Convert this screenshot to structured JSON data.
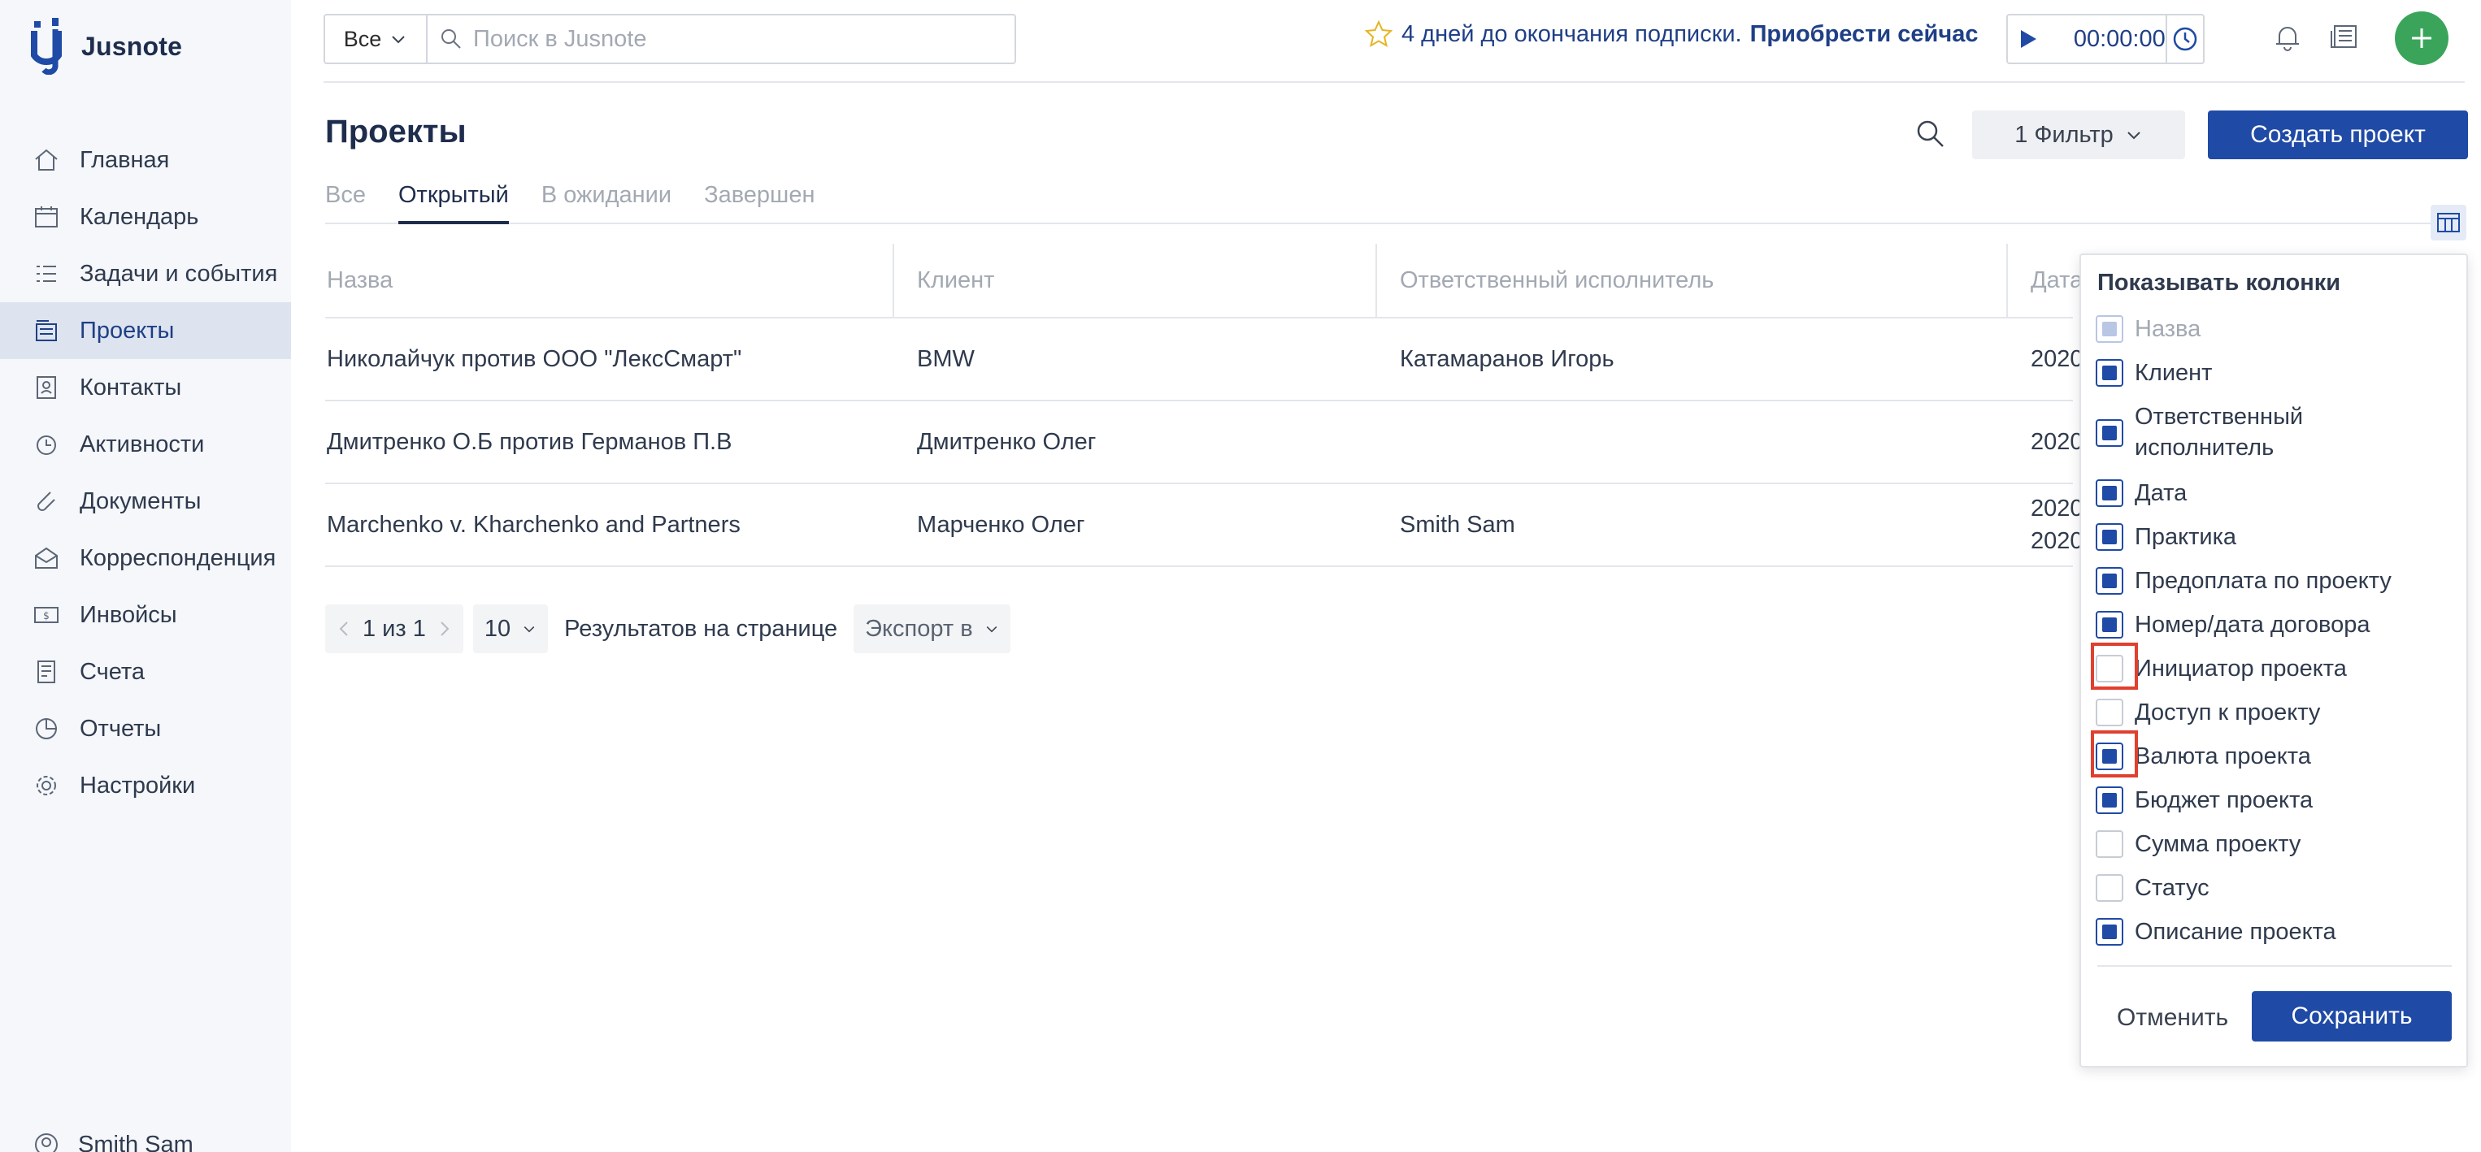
{
  "app": {
    "name": "Jusnote"
  },
  "sidebar": {
    "items": [
      {
        "label": "Главная",
        "icon": "home-icon"
      },
      {
        "label": "Календарь",
        "icon": "calendar-icon"
      },
      {
        "label": "Задачи и события",
        "icon": "tasks-icon"
      },
      {
        "label": "Проекты",
        "icon": "projects-icon",
        "active": true
      },
      {
        "label": "Контакты",
        "icon": "contacts-icon"
      },
      {
        "label": "Активности",
        "icon": "activity-icon"
      },
      {
        "label": "Документы",
        "icon": "documents-icon"
      },
      {
        "label": "Корреспонденция",
        "icon": "correspondence-icon"
      },
      {
        "label": "Инвойсы",
        "icon": "invoices-icon"
      },
      {
        "label": "Счета",
        "icon": "accounts-icon"
      },
      {
        "label": "Отчеты",
        "icon": "reports-icon"
      },
      {
        "label": "Настройки",
        "icon": "settings-icon"
      }
    ],
    "user": "Smith Sam"
  },
  "topbar": {
    "search_scope": "Все",
    "search_placeholder": "Поиск в Jusnote",
    "promo_text": "4 дней до окончания подписки.",
    "promo_link": "Приобрести сейчас",
    "timer": "00:00:00"
  },
  "main": {
    "title": "Проекты",
    "filter_label": "1 Фильтр",
    "create_label": "Создать проект",
    "tabs": [
      "Все",
      "Открытый",
      "В ожидании",
      "Завершен"
    ],
    "active_tab": 1,
    "columns": [
      "Назва",
      "Клиент",
      "Ответственный исполнитель",
      "Дата"
    ],
    "rows": [
      {
        "name": "Николайчук против ООО \"ЛексСмарт\"",
        "client": "BMW",
        "responsible": "Катамаранов Игорь",
        "date": "2020"
      },
      {
        "name": "Дмитренко О.Б против Германов П.В",
        "client": "Дмитренко Олег",
        "responsible": "",
        "date": "2020"
      },
      {
        "name": "Marchenko v. Kharchenko and Partners",
        "client": "Марченко Олег",
        "responsible": "Smith Sam",
        "date": "2020",
        "date2": "2020"
      }
    ],
    "pager": {
      "range": "1 из 1",
      "page_size": "10",
      "per_page_label": "Результатов на странице",
      "export_label": "Экспорт в"
    }
  },
  "column_panel": {
    "title": "Показывать колонки",
    "options": [
      {
        "label": "Назва",
        "checked": true,
        "disabled": true
      },
      {
        "label": "Клиент",
        "checked": true
      },
      {
        "label": "Ответственный исполнитель",
        "checked": true
      },
      {
        "label": "Дата",
        "checked": true
      },
      {
        "label": "Практика",
        "checked": true
      },
      {
        "label": "Предоплата по проекту",
        "checked": true
      },
      {
        "label": "Номер/дата договора",
        "checked": true
      },
      {
        "label": "Инициатор проекта",
        "checked": false,
        "highlighted": true
      },
      {
        "label": "Доступ к проекту",
        "checked": false
      },
      {
        "label": "Валюта проекта",
        "checked": true,
        "highlighted": true
      },
      {
        "label": "Бюджет проекта",
        "checked": true
      },
      {
        "label": "Сумма проекту",
        "checked": false
      },
      {
        "label": "Статус",
        "checked": false
      },
      {
        "label": "Описание проекта",
        "checked": true
      }
    ],
    "cancel_label": "Отменить",
    "save_label": "Сохранить"
  },
  "colors": {
    "primary": "#1f4aa6",
    "sidebar_bg": "#f5f7fb",
    "active_nav_bg": "#dde4ef",
    "add_button": "#3aa55a",
    "highlight": "#e0402f"
  }
}
